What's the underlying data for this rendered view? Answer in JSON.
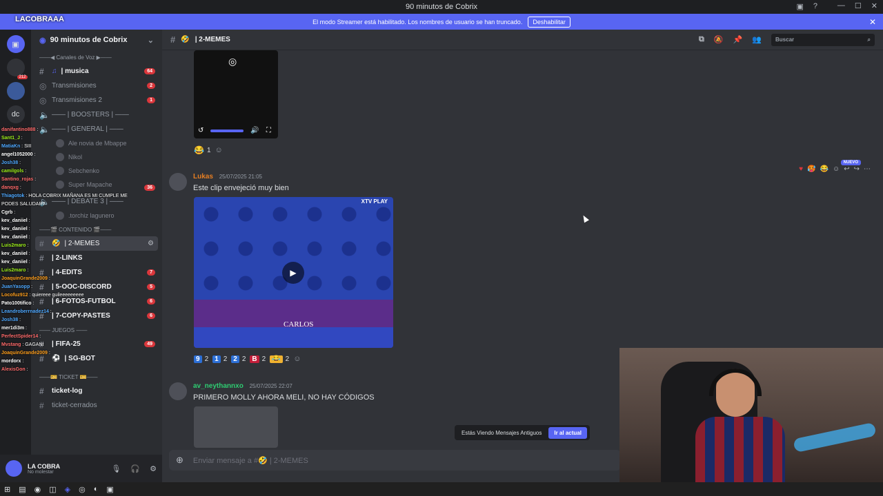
{
  "window": {
    "title": "90 minutos de Cobrix"
  },
  "banner": {
    "text": "El modo Streamer está habilitado. Los nombres de usuario se han truncado.",
    "button": "Deshabilitar"
  },
  "streamer_tag": "LACOBRAAA",
  "server": {
    "name": "90 minutos de Cobrix",
    "badge_count": "212"
  },
  "sidebar": {
    "voice_category": "——◀ Canales de Voz ▶——",
    "channels": [
      {
        "name": "| musica",
        "badge": "64"
      },
      {
        "name": "Transmisiones",
        "badge": "2"
      },
      {
        "name": "Transmisiones 2",
        "badge": "1"
      },
      {
        "name": "—— | BOOSTERS | ——"
      },
      {
        "name": "—— | GENERAL | ——"
      }
    ],
    "voice_users": [
      "Ale novia de Mbappe",
      "Nikol",
      "Sebchenko",
      "Super Mapache"
    ],
    "debate": {
      "name": "—— | DEBATE 3 | ——",
      "badge": "36"
    },
    "debate_user": ".torchiz lagunero",
    "content_category": "——🎬 CONTENIDO 🎬——",
    "text_channels": [
      {
        "name": "| 2-MEMES"
      },
      {
        "name": "| 2-LINKS"
      },
      {
        "name": "| 4-EDITS",
        "badge": "7"
      },
      {
        "name": "| 5-OOC-DISCORD",
        "badge": "5"
      },
      {
        "name": "| 6-FOTOS-FUTBOL",
        "badge": "6"
      },
      {
        "name": "| 7-COPY-PASTES",
        "badge": "6"
      }
    ],
    "games_category": "—— JUEGOS ——",
    "game_channels": [
      {
        "name": "| FIFA-25",
        "badge": "49"
      },
      {
        "name": "| SG-BOT"
      }
    ],
    "ticket_category": "——🎫 TICKET 🎫——",
    "ticket_channels": [
      {
        "name": "ticket-log"
      },
      {
        "name": "ticket-cerrados"
      }
    ]
  },
  "user_panel": {
    "name": "LA COBRA",
    "status": "No molestar"
  },
  "channel_header": {
    "name": "| 2-MEMES",
    "search_placeholder": "Buscar"
  },
  "top_media": {
    "reaction_count": "1"
  },
  "messages": [
    {
      "author": "Lukas",
      "time": "25/07/2025 21:05",
      "text": "Este clip envejeció muy bien",
      "video_caption": "CARLOS",
      "video_logo": "XTV PLAY",
      "reactions": [
        {
          "emoji": "9",
          "count": "2",
          "color": "#2c6fd6"
        },
        {
          "emoji": "1",
          "count": "2",
          "color": "#2c6fd6"
        },
        {
          "emoji": "2",
          "count": "2",
          "color": "#2c6fd6"
        },
        {
          "emoji": "B",
          "count": "2",
          "color": "#c41e3a"
        },
        {
          "emoji": "😂",
          "count": "2",
          "color": "#f0b232"
        }
      ]
    },
    {
      "author": "av_neythannxo",
      "time": "25/07/2025 22:07",
      "text": "PRIMERO MOLLY AHORA MELI, NO HAY CÓDIGOS"
    }
  ],
  "nuevo_label": "NUEVO",
  "old_messages": {
    "text": "Estás Viendo Mensajes Antiguos",
    "button": "Ir al actual"
  },
  "composer": {
    "placeholder": "Enviar mensaje a #🤣 | 2-MEMES"
  },
  "overlay_chat": [
    {
      "user": "danifantino888",
      "text": ":",
      "color": "#ff6b6b"
    },
    {
      "user": "Sant1_J",
      "text": ":",
      "color": "#9ef01a"
    },
    {
      "user": "MatiaKn",
      "text": ": SIII",
      "color": "#4ea8ff"
    },
    {
      "user": "angel1052000",
      "text": ":",
      "color": "#ffffff"
    },
    {
      "user": "Josh38",
      "text": ":",
      "color": "#4ea8ff"
    },
    {
      "user": "camilgols",
      "text": ":",
      "color": "#9ef01a"
    },
    {
      "user": "Santino_rojas",
      "text": ":",
      "color": "#ff6b6b"
    },
    {
      "user": "danqxg",
      "text": ":",
      "color": "#ff6b6b"
    },
    {
      "user": "Thiagotok",
      "text": ": HOLA COBRIX MAÑANA ES MI CUMPLE ME PODES SALUDAR?",
      "color": "#4ea8ff"
    },
    {
      "user": "Cgrb",
      "text": ":",
      "color": "#ffffff"
    },
    {
      "user": "kev_daniiel",
      "text": ":",
      "color": "#ffffff"
    },
    {
      "user": "kev_daniiel",
      "text": ":",
      "color": "#ffffff"
    },
    {
      "user": "kev_daniiel",
      "text": ":",
      "color": "#ffffff"
    },
    {
      "user": "Luis2maro",
      "text": ":",
      "color": "#9ef01a"
    },
    {
      "user": "kev_daniiel",
      "text": ":",
      "color": "#ffffff"
    },
    {
      "user": "kev_daniiel",
      "text": ":",
      "color": "#ffffff"
    },
    {
      "user": "Luis2maro",
      "text": ":",
      "color": "#9ef01a"
    },
    {
      "user": "JoaquinGrande2009",
      "text": ":",
      "color": "#ff9f1c"
    },
    {
      "user": "JuanYasopp",
      "text": ":",
      "color": "#4ea8ff"
    },
    {
      "user": "Locofuz912",
      "text": ": quiereee guileeeeeeeee",
      "color": "#ff9f1c"
    },
    {
      "user": "Pato100tifico",
      "text": ":",
      "color": "#ffffff"
    },
    {
      "user": "Leandroberrnadez14",
      "text": ":",
      "color": "#4ea8ff"
    },
    {
      "user": "Josh38",
      "text": ":",
      "color": "#4ea8ff"
    },
    {
      "user": "mer1di3m",
      "text": ":",
      "color": "#ffffff"
    },
    {
      "user": "PerfectSpider14",
      "text": ":",
      "color": "#ff6b6b"
    },
    {
      "user": "Mvstang",
      "text": ": GAGANI",
      "color": "#ff6b6b"
    },
    {
      "user": "JoaquinGrande2009",
      "text": ":",
      "color": "#ff9f1c"
    },
    {
      "user": "mordorx",
      "text": ":",
      "color": "#ffffff"
    },
    {
      "user": "AlexisGon",
      "text": ":",
      "color": "#ff6b6b"
    }
  ],
  "colors": {
    "accent": "#5865f2",
    "lukas": "#e67e22",
    "neythan": "#2ecc71"
  }
}
